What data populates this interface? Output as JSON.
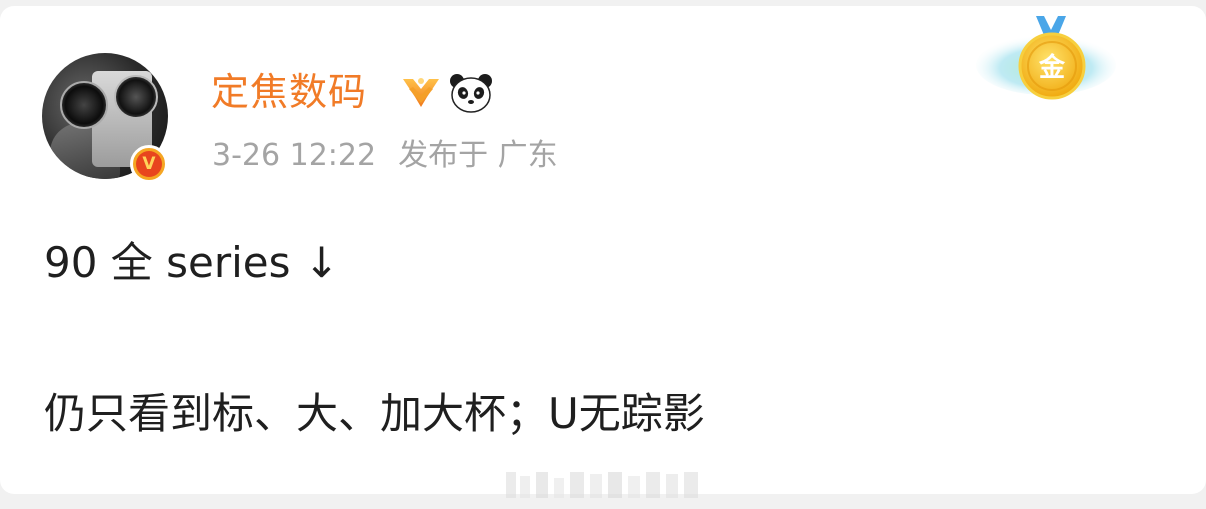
{
  "post": {
    "author": {
      "name": "定焦数码",
      "avatar_badge": "V",
      "badges": [
        "vip-medal-icon",
        "panda-icon"
      ]
    },
    "meta": {
      "time": "3-26 12:22",
      "location": "发布于 广东"
    },
    "medal_icon": {
      "name": "gold-medal-icon",
      "label": "金"
    },
    "content": {
      "line1": "90 全 series ↓",
      "line2": "仍只看到标、大、加大杯；U无踪影"
    }
  },
  "colors": {
    "username": "#f17b27",
    "meta": "#a4a4a4",
    "body_text": "#1f1f1f",
    "card_bg": "#ffffff",
    "page_bg": "#f1f1f1",
    "medal_gold": "#f6c21d"
  }
}
